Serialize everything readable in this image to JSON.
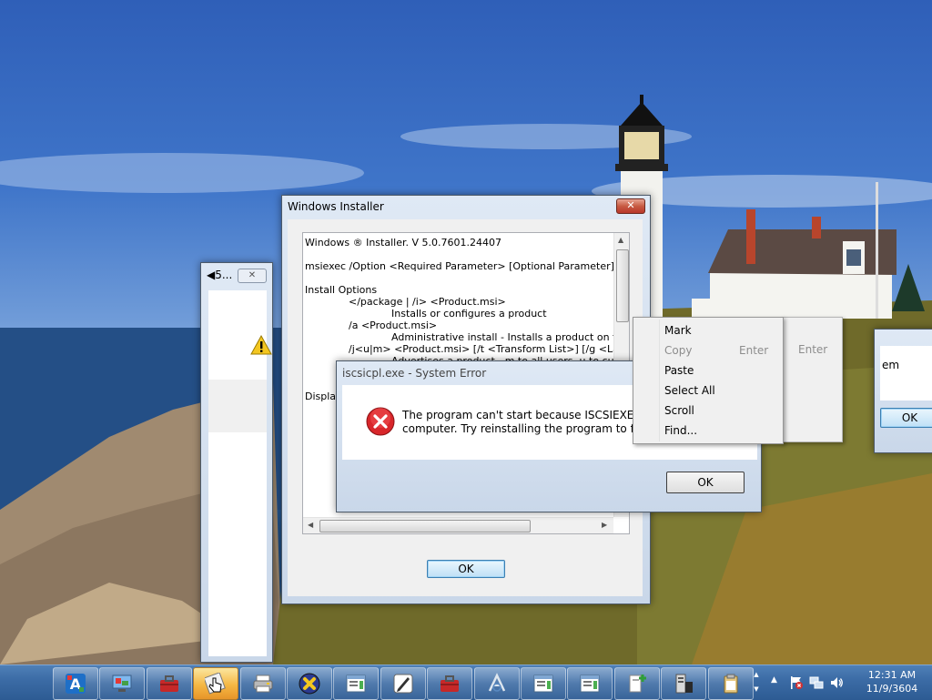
{
  "installer": {
    "title": "Windows Installer",
    "close_glyph": "✕",
    "ok_label": "OK",
    "lines": [
      "Windows ® Installer. V 5.0.7601.24407",
      "msiexec /Option <Required Parameter> [Optional Parameter]",
      "Install Options",
      "</package | /i> <Product.msi>",
      "Installs or configures a product",
      "/a <Product.msi>",
      "Administrative install - Installs a product on the netw",
      "/j<u|m> <Product.msi> [/t <Transform List>] [/g <Language ID",
      "Advertises a product - m to all users, u to current",
      "Display"
    ]
  },
  "system_error": {
    "title": "iscsicpl.exe - System Error",
    "message_line1": "The program can't start because ISCSIEXE.dll is n",
    "message_line2": "computer. Try reinstalling the program to fix this",
    "ok_label": "OK"
  },
  "context_menu": {
    "items": [
      {
        "label": "Mark",
        "shortcut": "",
        "disabled": false
      },
      {
        "label": "Copy",
        "shortcut": "Enter",
        "disabled": true
      },
      {
        "label": "Paste",
        "shortcut": "",
        "disabled": false
      },
      {
        "label": "Select All",
        "shortcut": "",
        "disabled": false
      },
      {
        "label": "Scroll",
        "shortcut": "",
        "disabled": false
      },
      {
        "label": "Find...",
        "shortcut": "",
        "disabled": false
      }
    ],
    "behind_shortcut": "Enter"
  },
  "left_window": {
    "title": "◀5..."
  },
  "right_window": {
    "text": "em",
    "ok_label": "OK"
  },
  "taskbar": {
    "icons": [
      "font-icon",
      "display-icon",
      "toolbox-icon",
      "hand-pointer-icon",
      "printer-icon",
      "x-circle-icon",
      "window-icon",
      "pen-icon",
      "toolbox-icon",
      "text-tool-icon",
      "window-icon",
      "window-icon",
      "document-plus-icon",
      "server-icon",
      "clipboard-icon"
    ],
    "clock_time": "12:31 AM",
    "clock_date": "11/9/3604"
  }
}
